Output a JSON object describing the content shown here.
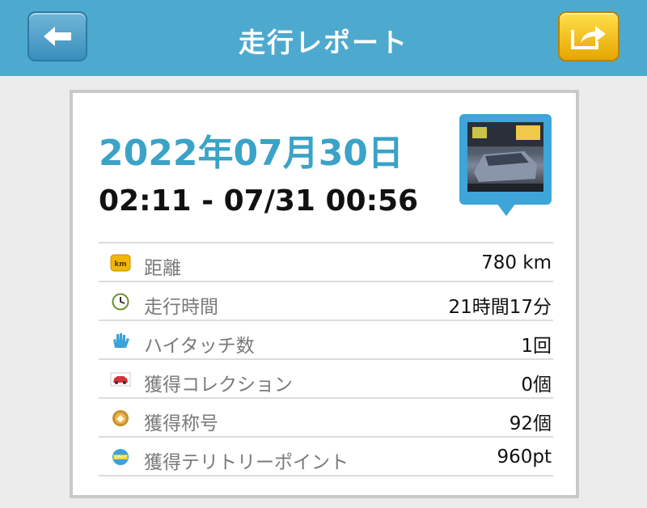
{
  "header": {
    "title": "走行レポート"
  },
  "report": {
    "date": "2022年07月30日",
    "time_range": "02:11 - 07/31 00:56"
  },
  "stats": [
    {
      "icon": "km-badge-icon",
      "label": "距離",
      "value": "780 km"
    },
    {
      "icon": "clock-icon",
      "label": "走行時間",
      "value": "21時間17分"
    },
    {
      "icon": "hi-touch-hand-icon",
      "label": "ハイタッチ数",
      "value": "1回"
    },
    {
      "icon": "car-icon",
      "label": "獲得コレクション",
      "value": "0個"
    },
    {
      "icon": "medal-icon",
      "label": "獲得称号",
      "value": "92個"
    },
    {
      "icon": "spot-badge-icon",
      "label": "獲得テリトリーポイント",
      "value": "960pt"
    }
  ],
  "colors": {
    "header": "#4ea9cf",
    "accent": "#3aa3c7",
    "share": "#f5c518"
  }
}
